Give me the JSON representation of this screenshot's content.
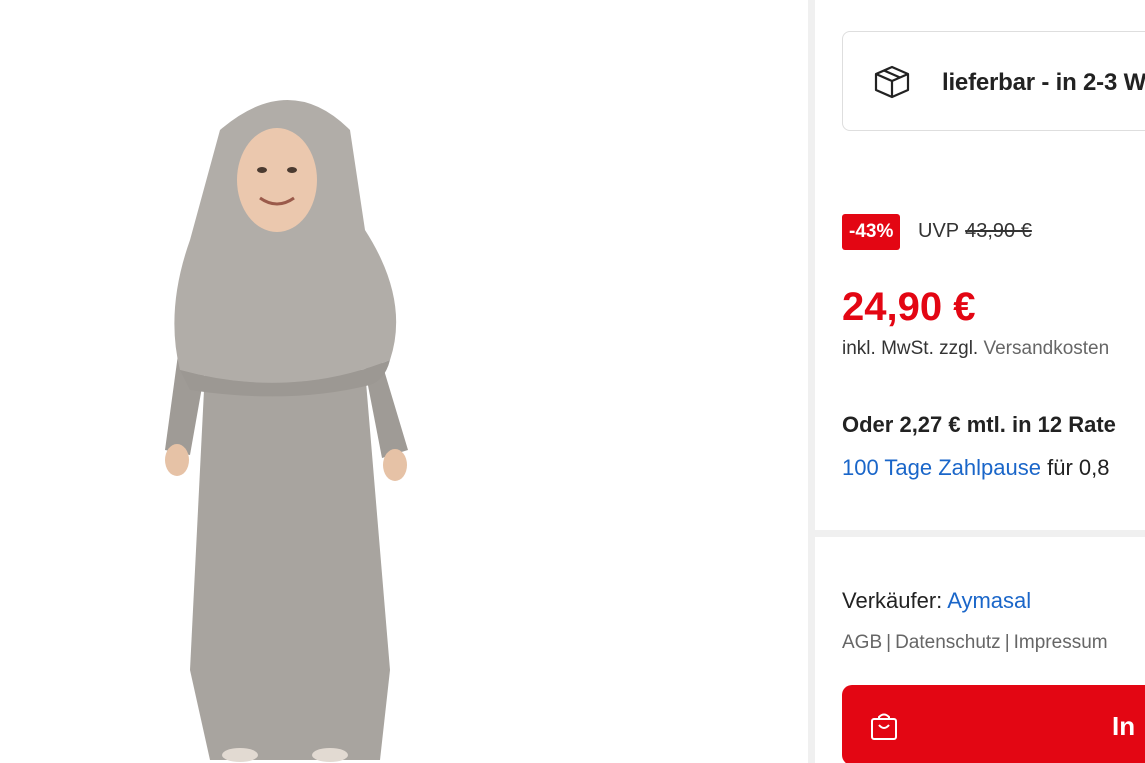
{
  "product": {
    "image_alt": "Kind in grauem Gebetskleid mit Hijab"
  },
  "delivery": {
    "icon": "package-icon",
    "text": "lieferbar - in 2-3 W"
  },
  "pricing": {
    "discount": "-43%",
    "uvp_label": "UVP",
    "uvp_old_price": "43,90 €",
    "price": "24,90 €",
    "tax_text": "inkl. MwSt. zzgl.",
    "shipping_link": "Versandkosten",
    "installment": "Oder 2,27 € mtl. in 12 Rate",
    "zahlpause_link": "100 Tage Zahlpause",
    "zahlpause_rest": " für 0,8"
  },
  "seller": {
    "label": "Verkäufer:",
    "name": "Aymasal",
    "links": [
      "AGB",
      "Datenschutz",
      "Impressum"
    ],
    "separator": "|"
  },
  "cart": {
    "icon": "shopping-bag-icon",
    "label": "In"
  },
  "colors": {
    "accent": "#e30613",
    "link": "#1a66c9",
    "divider": "#f0f0f0"
  }
}
